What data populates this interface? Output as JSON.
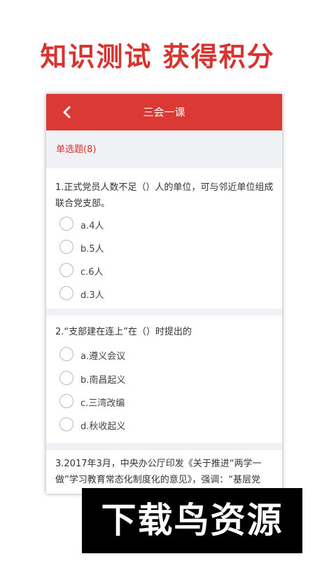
{
  "promo": {
    "title": "知识测试 获得积分"
  },
  "header": {
    "title": "三会一课",
    "back_icon": "chevron-left-icon"
  },
  "section": {
    "label": "单选题(8)"
  },
  "questions": [
    {
      "text": "1.正式党员人数不足（）人的单位，可与邻近单位组成联合党支部。",
      "options": [
        "a.4人",
        "b.5人",
        "c.6人",
        "d.3人"
      ]
    },
    {
      "text": "2.“支部建在连上”在（）时提出的",
      "options": [
        "a.遵义会议",
        "b.南昌起义",
        "c.三湾改编",
        "d.秋收起义"
      ]
    },
    {
      "text": "3.2017年3月，中央办公厅印发《关于推进“两学一做”学习教育常态化制度化的意见》，强调：“基层党",
      "options": []
    }
  ],
  "watermark": {
    "text": "下载鸟资源"
  },
  "colors": {
    "accent": "#db3a34",
    "background": "#f0f1f4"
  }
}
